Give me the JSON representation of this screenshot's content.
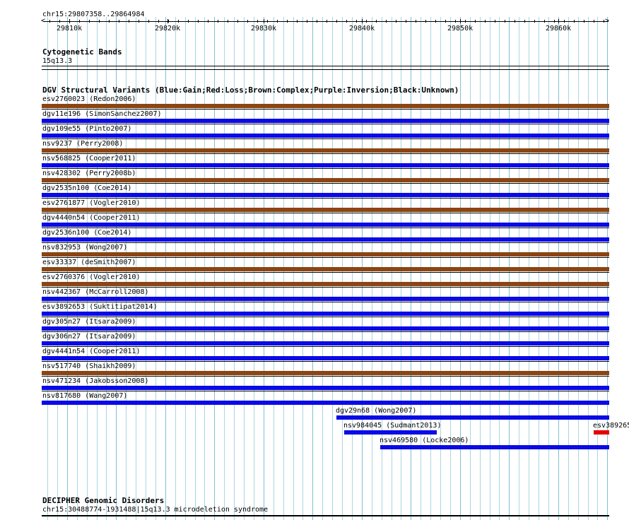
{
  "ruler": {
    "location": "chr15:29807358..29864984",
    "ticks": [
      "29810k",
      "29820k",
      "29830k",
      "29840k",
      "29850k",
      "29860k"
    ]
  },
  "cytoband": {
    "title": "Cytogenetic Bands",
    "band": "15q13.3"
  },
  "dgv": {
    "title": "DGV Structural Variants (Blue:Gain;Red:Loss;Brown:Complex;Purple:Inversion;Black:Unknown)",
    "colors": {
      "gain": "#0a0ae6",
      "loss": "#e60000",
      "complex": "#8b4513"
    },
    "features": [
      {
        "label": "esv2760023 (Redon2006)",
        "type": "complex"
      },
      {
        "label": "dgv11e196 (SimonSanchez2007)",
        "type": "gain"
      },
      {
        "label": "dgv109e55 (Pinto2007)",
        "type": "gain"
      },
      {
        "label": "nsv9237 (Perry2008)",
        "type": "complex"
      },
      {
        "label": "nsv568825 (Cooper2011)",
        "type": "gain"
      },
      {
        "label": "nsv428302 (Perry2008b)",
        "type": "complex"
      },
      {
        "label": "dgv2535n100 (Coe2014)",
        "type": "gain"
      },
      {
        "label": "esv2761877 (Vogler2010)",
        "type": "complex"
      },
      {
        "label": "dgv4440n54 (Cooper2011)",
        "type": "gain"
      },
      {
        "label": "dgv2536n100 (Coe2014)",
        "type": "gain"
      },
      {
        "label": "nsv832953 (Wong2007)",
        "type": "complex"
      },
      {
        "label": "esv33337 (deSmith2007)",
        "type": "complex"
      },
      {
        "label": "esv2760376 (Vogler2010)",
        "type": "complex"
      },
      {
        "label": "nsv442367 (McCarroll2008)",
        "type": "gain"
      },
      {
        "label": "esv3892653 (Suktitipat2014)",
        "type": "gain"
      },
      {
        "label": "dgv305n27 (Itsara2009)",
        "type": "gain"
      },
      {
        "label": "dgv306n27 (Itsara2009)",
        "type": "gain"
      },
      {
        "label": "dgv4441n54 (Cooper2011)",
        "type": "gain"
      },
      {
        "label": "nsv517740 (Shaikh2009)",
        "type": "complex"
      },
      {
        "label": "nsv471234 (Jakobsson2008)",
        "type": "gain"
      },
      {
        "label": "nsv817680 (Wang2007)",
        "type": "gain"
      },
      {
        "label": "dgv29n68 (Wong2007)",
        "type": "gain"
      },
      {
        "label": "nsv984045 (Sudmant2013)",
        "type": "gain"
      },
      {
        "label": "esv389265",
        "type": "loss"
      },
      {
        "label": "nsv469580 (Locke2006)",
        "type": "gain"
      }
    ]
  },
  "decipher": {
    "title": "DECIPHER Genomic Disorders",
    "feature": "chr15:30488774-1931488|15q13.3 microdeletion syndrome"
  }
}
